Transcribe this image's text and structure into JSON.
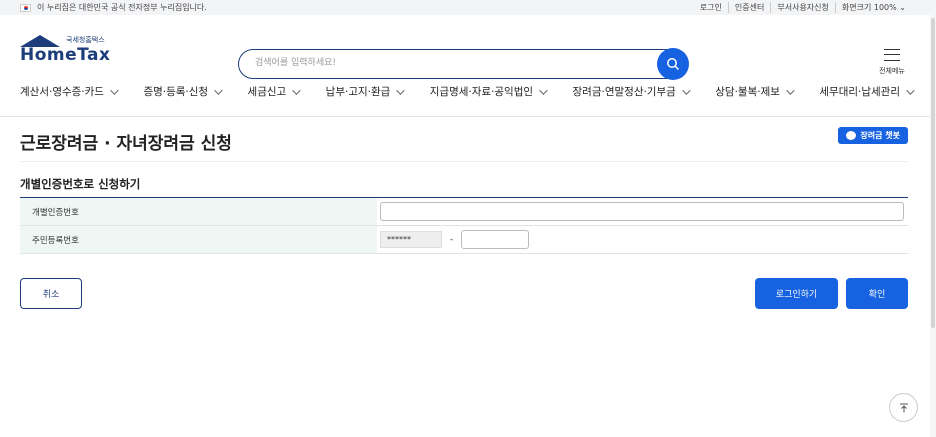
{
  "topbar": {
    "notice": "이 누리집은 대한민국 공식 전자정부 누리집입니다.",
    "links": [
      "로그인",
      "인증센터",
      "부서사용자신청",
      "화면크기 100%"
    ]
  },
  "logo": {
    "subtitle": "국세청홈택스",
    "name": "HomeTax"
  },
  "search": {
    "placeholder": "검색어를 입력하세요!"
  },
  "menu_button": {
    "label": "전체메뉴"
  },
  "nav": [
    "계산서·영수증·카드",
    "증명·등록·신청",
    "세금신고",
    "납부·고지·환급",
    "지급명세·자료·공익법인",
    "장려금·연말정산·기부금",
    "상담·불복·제보",
    "세무대리·납세관리"
  ],
  "page": {
    "title": "근로장려금 · 자녀장려금 신청",
    "chatbot_label": "장려금 챗봇",
    "section_title": "개별인증번호로 신청하기"
  },
  "form": {
    "rows": [
      {
        "label": "개별인증번호"
      },
      {
        "label": "주민등록번호",
        "masked_front": "******",
        "separator": "-"
      }
    ]
  },
  "buttons": {
    "cancel": "취소",
    "login": "로그인하기",
    "confirm": "확인"
  },
  "colors": {
    "primary": "#1762e0",
    "navy": "#1c3d7a",
    "table_header_bg": "#eef7f4"
  }
}
